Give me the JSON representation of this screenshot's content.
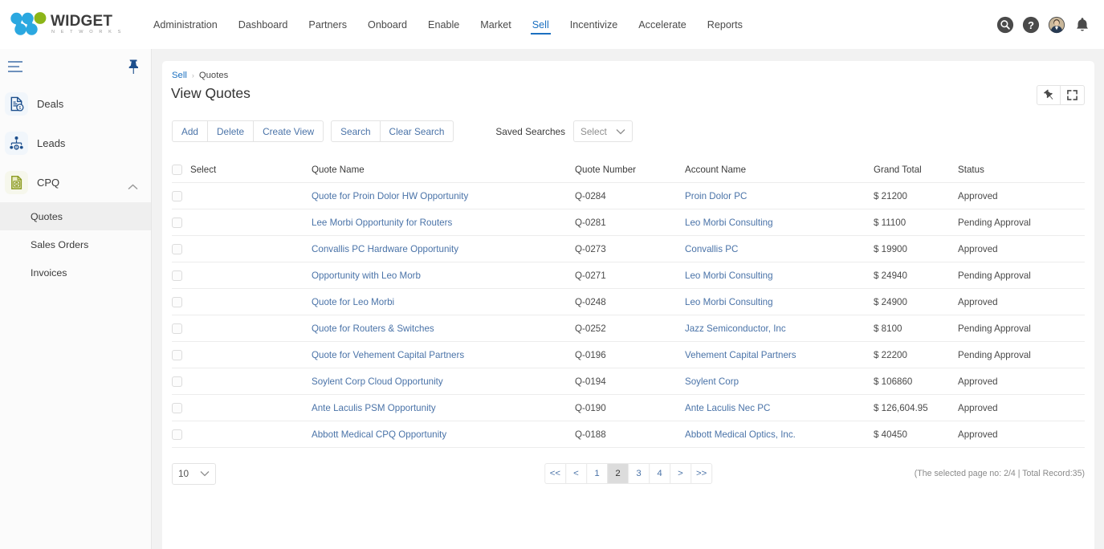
{
  "brand": {
    "name": "WIDGET",
    "tagline": "N E T W O R K S",
    "blue": "#2ba8e0",
    "green": "#8cb518"
  },
  "topnav": {
    "items": [
      {
        "label": "Administration",
        "active": false
      },
      {
        "label": "Dashboard",
        "active": false
      },
      {
        "label": "Partners",
        "active": false
      },
      {
        "label": "Onboard",
        "active": false
      },
      {
        "label": "Enable",
        "active": false
      },
      {
        "label": "Market",
        "active": false
      },
      {
        "label": "Sell",
        "active": true
      },
      {
        "label": "Incentivize",
        "active": false
      },
      {
        "label": "Accelerate",
        "active": false
      },
      {
        "label": "Reports",
        "active": false
      }
    ],
    "icons": [
      "search-icon",
      "help-icon",
      "avatar",
      "notification-bell-icon"
    ]
  },
  "sidebar": {
    "menu_icon": "hamburger-menu-icon",
    "pin_icon": "pin-icon",
    "items": [
      {
        "label": "Deals",
        "icon": "deals-document-icon"
      },
      {
        "label": "Leads",
        "icon": "leads-people-icon"
      },
      {
        "label": "CPQ",
        "icon": "cpq-money-document-icon",
        "expanded": true
      }
    ],
    "subitems": [
      {
        "label": "Quotes",
        "active": true
      },
      {
        "label": "Sales Orders",
        "active": false
      },
      {
        "label": "Invoices",
        "active": false
      }
    ]
  },
  "breadcrumb": {
    "parent": "Sell",
    "separator": "›",
    "current": "Quotes"
  },
  "page": {
    "title": "View Quotes"
  },
  "corner_actions": [
    {
      "name": "pin-button",
      "icon": "pin-icon"
    },
    {
      "name": "expand-button",
      "icon": "expand-fullscreen-icon"
    }
  ],
  "toolbar": {
    "group1": [
      "Add",
      "Delete",
      "Create View"
    ],
    "group2": [
      "Search",
      "Clear Search"
    ],
    "saved_searches_label": "Saved Searches",
    "saved_searches_value": "Select"
  },
  "table": {
    "headers": [
      "Select",
      "Quote Name",
      "Quote Number",
      "Account Name",
      "Grand Total",
      "Status"
    ],
    "rows": [
      {
        "quote_name": "Quote for Proin Dolor HW Opportunity",
        "quote_number": "Q-0284",
        "account_name": "Proin Dolor PC",
        "grand_total": "$ 21200",
        "status": "Approved"
      },
      {
        "quote_name": "Lee Morbi Opportunity for Routers",
        "quote_number": "Q-0281",
        "account_name": "Leo Morbi Consulting",
        "grand_total": "$ 11100",
        "status": "Pending Approval"
      },
      {
        "quote_name": "Convallis PC Hardware Opportunity",
        "quote_number": "Q-0273",
        "account_name": "Convallis PC",
        "grand_total": "$ 19900",
        "status": "Approved"
      },
      {
        "quote_name": "Opportunity with Leo Morb",
        "quote_number": "Q-0271",
        "account_name": "Leo Morbi Consulting",
        "grand_total": "$ 24940",
        "status": "Pending Approval"
      },
      {
        "quote_name": "Quote for Leo Morbi",
        "quote_number": "Q-0248",
        "account_name": "Leo Morbi Consulting",
        "grand_total": "$ 24900",
        "status": "Approved"
      },
      {
        "quote_name": "Quote for Routers & Switches",
        "quote_number": "Q-0252",
        "account_name": "Jazz Semiconductor, Inc",
        "grand_total": "$ 8100",
        "status": "Pending Approval"
      },
      {
        "quote_name": "Quote for Vehement Capital Partners",
        "quote_number": "Q-0196",
        "account_name": "Vehement Capital Partners",
        "grand_total": "$ 22200",
        "status": "Pending Approval"
      },
      {
        "quote_name": "Soylent Corp Cloud Opportunity",
        "quote_number": "Q-0194",
        "account_name": "Soylent Corp",
        "grand_total": "$ 106860",
        "status": "Approved"
      },
      {
        "quote_name": "Ante Laculis PSM Opportunity",
        "quote_number": "Q-0190",
        "account_name": "Ante Laculis Nec PC",
        "grand_total": "$ 126,604.95",
        "status": "Approved"
      },
      {
        "quote_name": "Abbott Medical CPQ Opportunity",
        "quote_number": "Q-0188",
        "account_name": "Abbott Medical Optics, Inc.",
        "grand_total": "$ 40450",
        "status": "Approved"
      }
    ]
  },
  "footer": {
    "rows_per_page": "10",
    "pages": [
      {
        "label": "<<",
        "active": false
      },
      {
        "label": "<",
        "active": false
      },
      {
        "label": "1",
        "active": false
      },
      {
        "label": "2",
        "active": true
      },
      {
        "label": "3",
        "active": false
      },
      {
        "label": "4",
        "active": false
      },
      {
        "label": ">",
        "active": false
      },
      {
        "label": ">>",
        "active": false
      }
    ],
    "record_info": "(The selected page no: 2/4 | Total Record:35)"
  }
}
